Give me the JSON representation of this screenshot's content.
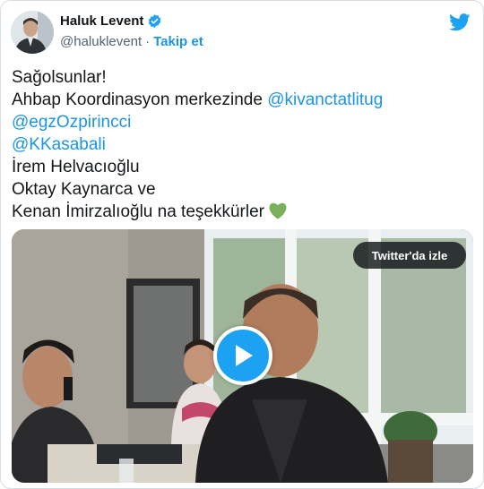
{
  "author": {
    "display_name": "Haluk Levent",
    "handle": "@haluklevent",
    "separator": "·",
    "follow_label": "Takip et",
    "verified": true
  },
  "tweet": {
    "lines": [
      {
        "text": "Sağolsunlar!"
      },
      {
        "text": "Ahbap Koordinasyon merkezinde ",
        "mention": "@kivanctatlitug"
      },
      {
        "mention": "@egzOzpirincci"
      },
      {
        "mention": "@KKasabali"
      },
      {
        "text": "İrem Helvacıoğlu"
      },
      {
        "text": "Oktay Kaynarca ve"
      },
      {
        "text": "Kenan İmirzalıoğlu na teşekkürler",
        "emoji": "green-heart"
      }
    ]
  },
  "media": {
    "watch_label": "Twitter'da izle",
    "type": "video"
  },
  "colors": {
    "link": "#1b95e0",
    "twitter_blue": "#1da1f2",
    "text": "#14171a",
    "secondary": "#536471",
    "heart": "#78b159"
  }
}
